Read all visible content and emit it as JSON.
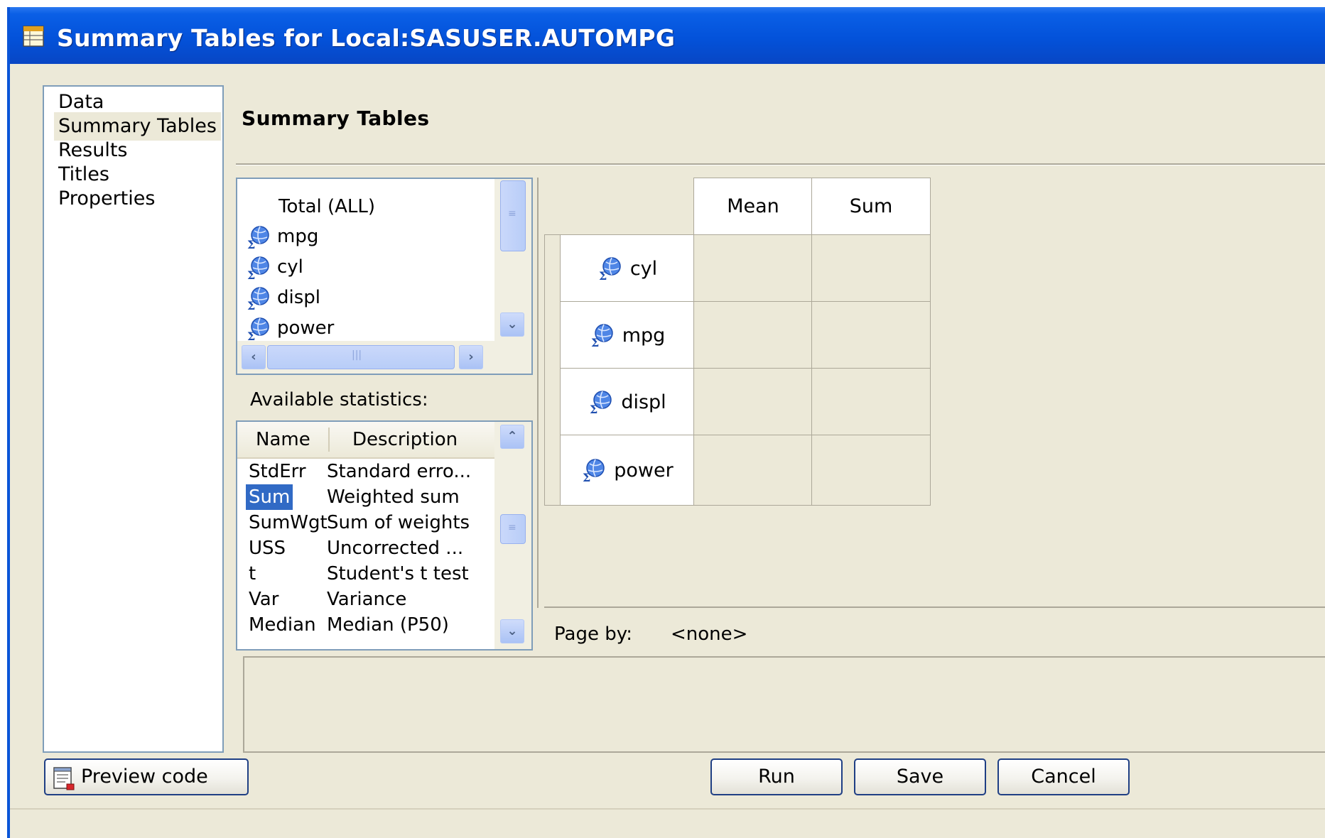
{
  "window": {
    "title": "Summary Tables for Local:SASUSER.AUTOMPG",
    "icon": "table-icon"
  },
  "nav": {
    "items": [
      "Data",
      "Summary Tables",
      "Results",
      "Titles",
      "Properties"
    ],
    "selected": "Summary Tables"
  },
  "page": {
    "title": "Summary Tables"
  },
  "variables": {
    "items": [
      "Total (ALL)",
      "mpg",
      "cyl",
      "displ",
      "power"
    ],
    "icon": "analysis-variable-icon"
  },
  "statistics": {
    "label": "Available statistics:",
    "columns": [
      "Name",
      "Description"
    ],
    "rows": [
      {
        "name": "StdErr",
        "description": "Standard erro..."
      },
      {
        "name": "Sum",
        "description": "Weighted sum"
      },
      {
        "name": "SumWgt",
        "description": "Sum of weights"
      },
      {
        "name": "USS",
        "description": "Uncorrected ..."
      },
      {
        "name": "t",
        "description": "Student's t test"
      },
      {
        "name": "Var",
        "description": "Variance"
      },
      {
        "name": "Median",
        "description": "Median (P50)"
      }
    ],
    "selected": "Sum"
  },
  "summary_table": {
    "columns": [
      "Mean",
      "Sum"
    ],
    "rows": [
      "cyl",
      "mpg",
      "displ",
      "power"
    ]
  },
  "page_by": {
    "label": "Page by:",
    "value": "<none>"
  },
  "buttons": {
    "preview": "Preview code",
    "run": "Run",
    "save": "Save",
    "cancel": "Cancel"
  }
}
